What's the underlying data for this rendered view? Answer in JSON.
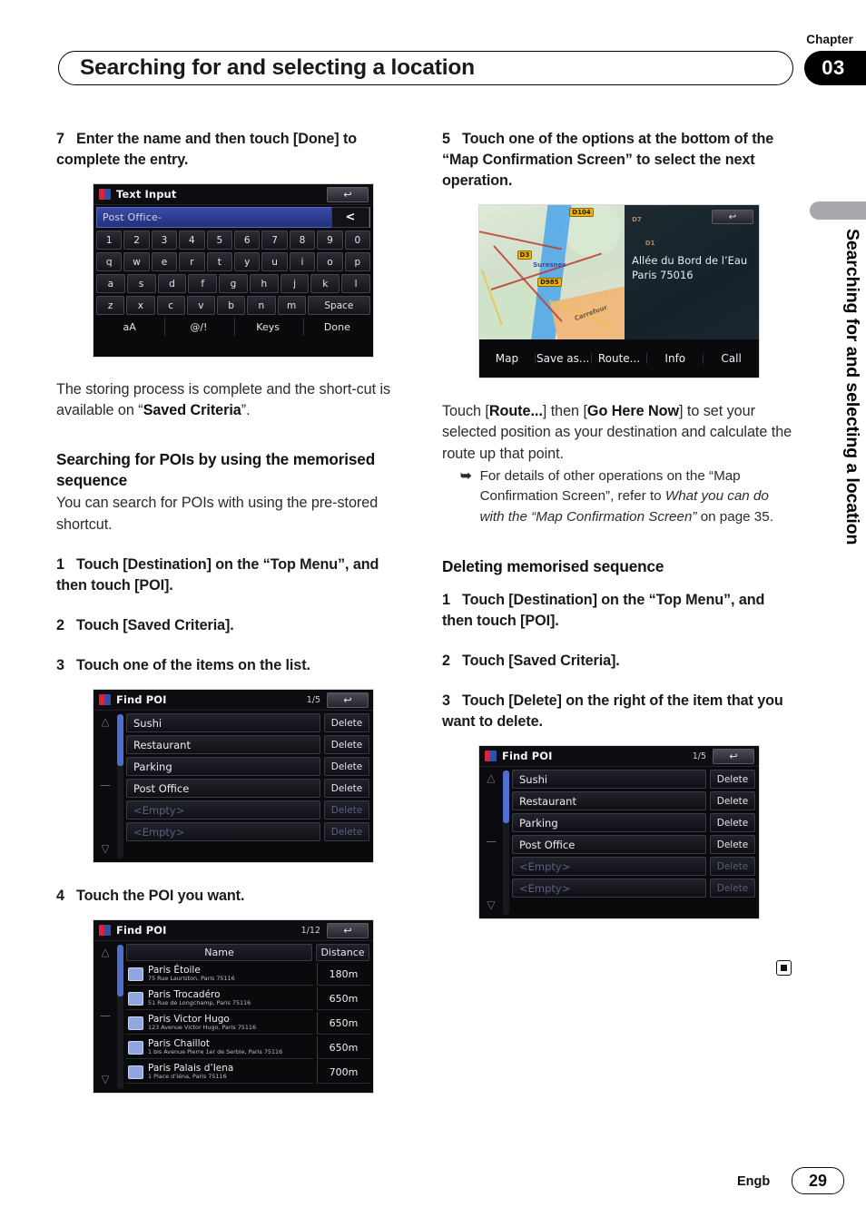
{
  "header": {
    "chapter_label": "Chapter",
    "chapter_number": "03",
    "title": "Searching for and selecting a location"
  },
  "side_tab": {
    "text": "Searching for and selecting a location"
  },
  "footer": {
    "language": "Engb",
    "page_number": "29"
  },
  "left_column": {
    "step7_num": "7",
    "step7_text": "Enter the name and then touch [Done] to complete the entry.",
    "text_input_shot": {
      "title": "Text Input",
      "back_icon": "↩",
      "field_value": "Post Office-",
      "delete_char_label": "<",
      "row_numbers": [
        "1",
        "2",
        "3",
        "4",
        "5",
        "6",
        "7",
        "8",
        "9",
        "0"
      ],
      "row_q": [
        "q",
        "w",
        "e",
        "r",
        "t",
        "y",
        "u",
        "i",
        "o",
        "p"
      ],
      "row_a": [
        "a",
        "s",
        "d",
        "f",
        "g",
        "h",
        "j",
        "k",
        "l"
      ],
      "row_z": [
        "z",
        "x",
        "c",
        "v",
        "b",
        "n",
        "m"
      ],
      "space_label": "Space",
      "fn_row": [
        "aA",
        "@/!",
        "Keys",
        "Done"
      ]
    },
    "para1_before": "The storing process is complete and the short-cut is available on “",
    "para1_bold": "Saved Criteria",
    "para1_after": "”.",
    "heading": "Searching for POIs by using the memorised sequence",
    "para2": "You can search for POIs with using the pre-stored shortcut.",
    "step1_num": "1",
    "step1_text": "Touch [Destination] on the “Top Menu”, and then touch [POI].",
    "step2_num": "2",
    "step2_text": "Touch [Saved Criteria].",
    "step3_num": "3",
    "step3_text": "Touch one of the items on the list.",
    "saved_criteria_shot": {
      "title": "Find POI",
      "page_indicator": "1/5",
      "back_icon": "↩",
      "rows": [
        {
          "name": "Sushi",
          "delete": "Delete",
          "empty": false
        },
        {
          "name": "Restaurant",
          "delete": "Delete",
          "empty": false
        },
        {
          "name": "Parking",
          "delete": "Delete",
          "empty": false
        },
        {
          "name": "Post Office",
          "delete": "Delete",
          "empty": false
        },
        {
          "name": "<Empty>",
          "delete": "Delete",
          "empty": true
        },
        {
          "name": "<Empty>",
          "delete": "Delete",
          "empty": true
        }
      ]
    },
    "step4_num": "4",
    "step4_text": "Touch the POI you want.",
    "results_shot": {
      "title": "Find POI",
      "page_indicator": "1/12",
      "back_icon": "↩",
      "col_name": "Name",
      "col_distance": "Distance",
      "rows": [
        {
          "name": "Paris Étoile",
          "address": "75 Rue Lauriston, Paris 75116",
          "distance": "180m"
        },
        {
          "name": "Paris Trocadéro",
          "address": "51 Rue de Longchamp, Paris 75116",
          "distance": "650m"
        },
        {
          "name": "Paris Victor Hugo",
          "address": "123 Avenue Victor Hugo, Paris 75116",
          "distance": "650m"
        },
        {
          "name": "Paris Chaillot",
          "address": "1 bis Avenue Pierre 1er de Serbie, Paris 75116",
          "distance": "650m"
        },
        {
          "name": "Paris Palais d’Iena",
          "address": "1 Place d’Iéna, Paris 75116",
          "distance": "700m"
        }
      ]
    }
  },
  "right_column": {
    "step5_num": "5",
    "step5_text": "Touch one of the options at the bottom of the “Map Confirmation Screen” to select the next operation.",
    "map_shot": {
      "back_icon": "↩",
      "address_line1": "Allée du Bord de l’Eau",
      "address_line2": "Paris 75016",
      "road_labels": [
        "D104",
        "D3",
        "D985",
        "D7",
        "D1"
      ],
      "place_labels": [
        "Suresnes",
        "Carrefour"
      ],
      "bottom_buttons": [
        "Map",
        "Save as...",
        "Route...",
        "Info",
        "Call"
      ]
    },
    "para_route_1": "Touch [",
    "para_route_bold1": "Route...",
    "para_route_2": "] then [",
    "para_route_bold2": "Go Here Now",
    "para_route_3": "] to set your selected position as your destination and calculate the route up that point.",
    "note_marker": "➥",
    "note_1": "For details of other operations on the “Map Confirmation Screen”, refer to ",
    "note_italic": "What you can do with the “Map Confirmation Screen”",
    "note_2": " on page 35.",
    "heading2": "Deleting memorised sequence",
    "d_step1_num": "1",
    "d_step1_text": "Touch [Destination] on the “Top Menu”, and then touch [POI].",
    "d_step2_num": "2",
    "d_step2_text": "Touch [Saved Criteria].",
    "d_step3_num": "3",
    "d_step3_text": "Touch [Delete] on the right of the item that you want to delete.",
    "delete_shot": {
      "title": "Find POI",
      "page_indicator": "1/5",
      "back_icon": "↩",
      "rows": [
        {
          "name": "Sushi",
          "delete": "Delete",
          "empty": false
        },
        {
          "name": "Restaurant",
          "delete": "Delete",
          "empty": false
        },
        {
          "name": "Parking",
          "delete": "Delete",
          "empty": false
        },
        {
          "name": "Post Office",
          "delete": "Delete",
          "empty": false
        },
        {
          "name": "<Empty>",
          "delete": "Delete",
          "empty": true
        },
        {
          "name": "<Empty>",
          "delete": "Delete",
          "empty": true
        }
      ]
    }
  }
}
